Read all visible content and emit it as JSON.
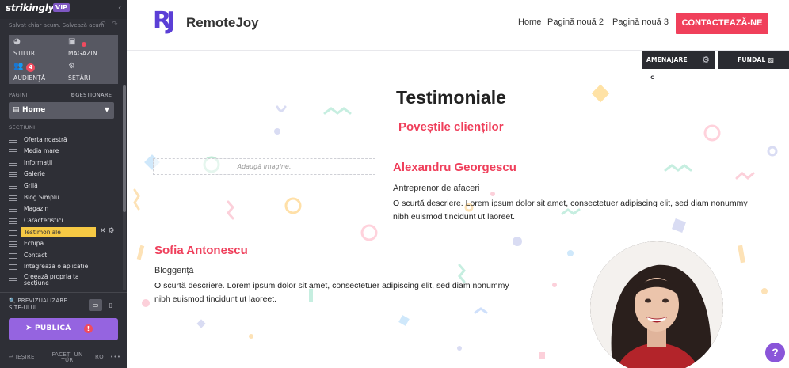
{
  "sidebar": {
    "logo": "strikingly",
    "vip": "VIP",
    "saved_text": "Salvat chiar acum.",
    "save_now": "Salvează acum",
    "grid": [
      {
        "label": "STILURI",
        "icon": "palette-icon"
      },
      {
        "label": "MAGAZIN",
        "icon": "bag-icon"
      },
      {
        "label": "AUDIENȚĂ",
        "icon": "people-icon",
        "badge": "4"
      },
      {
        "label": "SETĂRI",
        "icon": "gear-icon"
      }
    ],
    "pages_label": "PAGINI",
    "manage_label": "GESTIONARE",
    "current_page": "Home",
    "sections_label": "SECȚIUNI",
    "sections": [
      "Oferta noastră",
      "Media mare",
      "Informații",
      "Galerie",
      "Grilă",
      "Blog Simplu",
      "Magazin",
      "Caracteristici",
      "Testimoniale",
      "Echipa",
      "Contact",
      "Integrează o aplicație",
      "Creează propria ta secțiune"
    ],
    "active_section": "Testimoniale",
    "preview": "PREVIZUALIZARE SITE-ULUI",
    "publish": "PUBLICĂ",
    "publish_warning": "!",
    "exit": "IEȘIRE",
    "tour": "FACEȚI UN TUR",
    "lang": "RO",
    "more": "•••"
  },
  "site": {
    "brand_mark": "RJ",
    "brand_name": "RemoteJoy",
    "nav": [
      "Home",
      "Pagină nouă 2",
      "Pagină nouă 3"
    ],
    "cta": "CONTACTEAZĂ-NE"
  },
  "editor": {
    "amenajare": "AMENAJARE",
    "amenajare_badge": "C",
    "fundal": "FUNDAL"
  },
  "section": {
    "title": "Testimoniale",
    "subtitle": "Poveștile clienților",
    "image_placeholder": "Adaugă imagine.",
    "testimonials": [
      {
        "name": "Alexandru Georgescu",
        "role": "Antreprenor de afaceri",
        "desc": "O scurtă descriere. Lorem ipsum dolor sit amet, consectetuer adipiscing elit, sed diam nonummy nibh euismod tincidunt ut laoreet."
      },
      {
        "name": "Sofia Antonescu",
        "role": "Bloggeriță",
        "desc": "O scurtă descriere. Lorem ipsum dolor sit amet, consectetuer adipiscing elit, sed diam nonummy nibh euismod tincidunt ut laoreet."
      }
    ]
  },
  "help": "?",
  "colors": {
    "accent": "#ef3f5b",
    "brand": "#5b3fd6",
    "publish": "#9564e0",
    "active_section": "#f6c944"
  }
}
